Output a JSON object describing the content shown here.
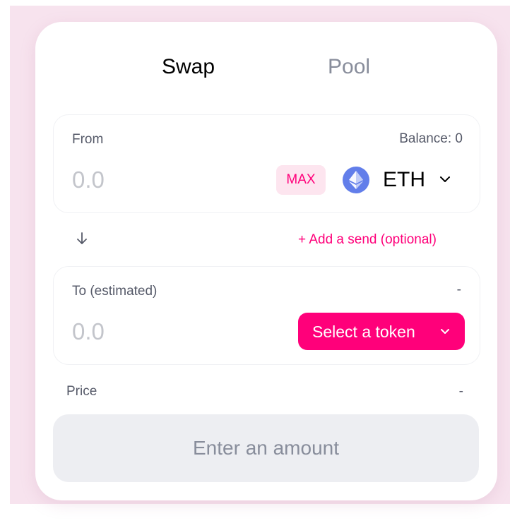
{
  "tabs": {
    "swap": "Swap",
    "pool": "Pool"
  },
  "from": {
    "label": "From",
    "balance": "Balance: 0",
    "amount_placeholder": "0.0",
    "max_label": "MAX",
    "token": "ETH",
    "token_icon": "ethereum-icon"
  },
  "switch": {
    "arrow_icon": "arrow-down-icon",
    "add_send": "+ Add a send (optional)"
  },
  "to": {
    "label": "To (estimated)",
    "balance": "-",
    "amount_placeholder": "0.0",
    "select_token": "Select a token"
  },
  "price": {
    "label": "Price",
    "value": "-"
  },
  "submit": {
    "label": "Enter an amount"
  },
  "colors": {
    "accent": "#ff007a",
    "accent_light": "#fde5ef",
    "page_background": "#f7e3ee",
    "disabled_button": "#edeef2",
    "muted_text": "#888d9b",
    "eth_blue": "#627eea"
  }
}
